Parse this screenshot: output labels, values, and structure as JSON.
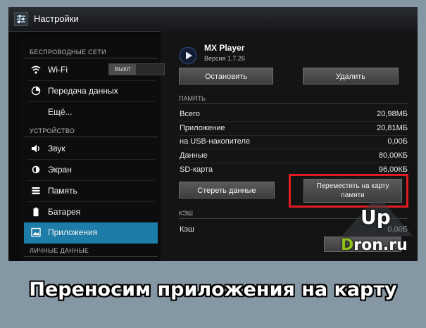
{
  "window": {
    "title": "Настройки",
    "icon": "settings-sliders-icon"
  },
  "sidebar": {
    "sections": [
      {
        "label": "БЕСПРОВОДНЫЕ СЕТИ"
      },
      {
        "label": "УСТРОЙСТВО"
      },
      {
        "label": "ЛИЧНЫЕ ДАННЫЕ"
      }
    ],
    "items": [
      {
        "label": "Wi-Fi",
        "icon": "wifi-icon",
        "toggle": "ВЫКЛ"
      },
      {
        "label": "Передача данных",
        "icon": "data-usage-icon"
      },
      {
        "label": "Ещё..."
      },
      {
        "label": "Звук",
        "icon": "speaker-icon"
      },
      {
        "label": "Экран",
        "icon": "brightness-icon"
      },
      {
        "label": "Память",
        "icon": "storage-icon"
      },
      {
        "label": "Батарея",
        "icon": "battery-icon"
      },
      {
        "label": "Приложения",
        "icon": "apps-icon",
        "selected": true
      }
    ]
  },
  "app": {
    "name": "MX Player",
    "version": "Версия 1.7.26",
    "icon": "play-icon",
    "stop_label": "Остановить",
    "delete_label": "Удалить"
  },
  "storage": {
    "heading": "ПАМЯТЬ",
    "rows": [
      {
        "label": "Всего",
        "value": "20,98МБ"
      },
      {
        "label": "Приложение",
        "value": "20,81МБ"
      },
      {
        "label": "на USB-накопителе",
        "value": "0,00Б"
      },
      {
        "label": "Данные",
        "value": "80,00КБ"
      },
      {
        "label": "SD-карта",
        "value": "96,00КБ"
      }
    ],
    "clear_label": "Стереть данные",
    "move_label_line1": "Переместить на карту",
    "move_label_line2": "памяти"
  },
  "cache": {
    "heading": "КЭШ",
    "row_label": "Кэш",
    "row_value": "0,00Б"
  },
  "watermark": {
    "line1": "Up",
    "line2_first": "D",
    "line2_rest": "ron.ru"
  },
  "caption": "Переносим приложения на карту",
  "colors": {
    "accent": "#1d7ca8",
    "highlight": "#e01b24",
    "logo_green": "#8fc21a"
  }
}
